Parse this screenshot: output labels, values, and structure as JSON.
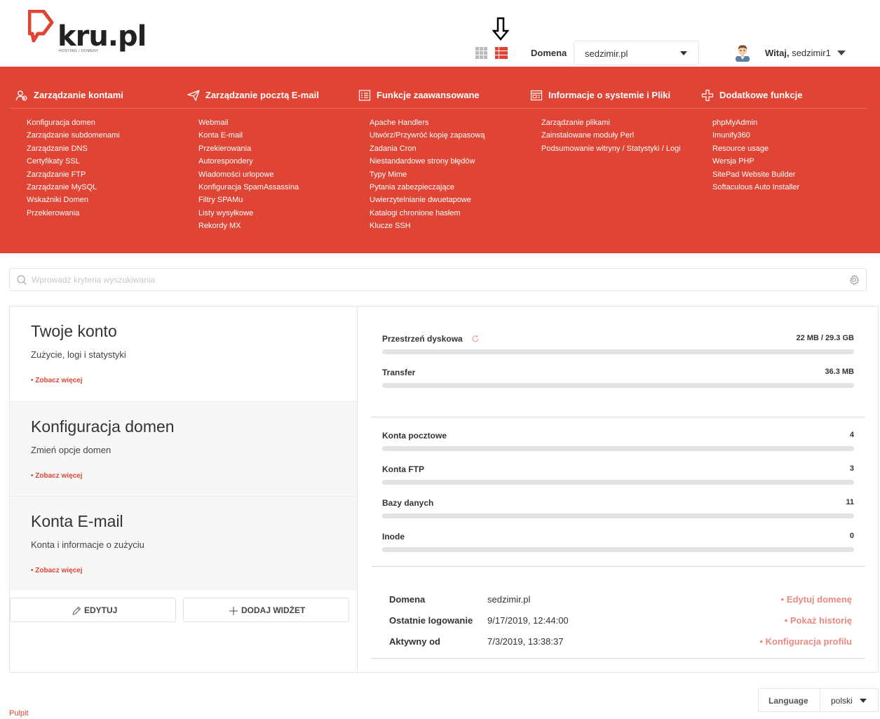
{
  "header": {
    "logo_text": "kru.pl",
    "logo_tagline": "HOSTING / DOMENY",
    "domain_label": "Domena",
    "domain_value": "sedzimir.pl",
    "greeting_prefix": "Witaj,",
    "username": "sedzimir1"
  },
  "menu": {
    "columns": [
      {
        "title": "Zarządzanie kontami",
        "icon": "users-icon",
        "items": [
          "Konfiguracja domen",
          "Zarządzanie subdomenami",
          "Zarządzanie DNS",
          "Certyfikaty SSL",
          "Zarządzanie FTP",
          "Zarządzanie MySQL",
          "Wskaźniki Domen",
          "Przekierowania"
        ]
      },
      {
        "title": "Zarządzanie pocztą E-mail",
        "icon": "paper-plane-icon",
        "items": [
          "Webmail",
          "Konta E-mail",
          "Przekierowania",
          "Autorespondery",
          "Wiadomości urlopowe",
          "Konfiguracja SpamAssassina",
          "Filtry SPAMu",
          "Listy wysyłkowe",
          "Rekordy MX"
        ]
      },
      {
        "title": "Funkcje zaawansowane",
        "icon": "list-icon",
        "items": [
          "Apache Handlers",
          "Utwórz/Przywróć kopię zapasową",
          "Zadania Cron",
          "Niestandardowe strony błędów",
          "Typy Mime",
          "Pytania zabezpieczające",
          "Uwierzytelnianie dwuetapowe",
          "Katalogi chronione hasłem",
          "Klucze SSH"
        ]
      },
      {
        "title": "Informacje o systemie i Pliki",
        "icon": "window-icon",
        "items": [
          "Zarządzanie plikami",
          "Zainstalowane moduły Perl",
          "Podsumowanie witryny / Statystyki / Logi"
        ]
      },
      {
        "title": "Dodatkowe funkcje",
        "icon": "plus-icon",
        "items": [
          "phpMyAdmin",
          "Imunify360",
          "Resource usage",
          "Wersja PHP",
          "SitePad Website Builder",
          "Softaculous Auto Installer"
        ]
      }
    ]
  },
  "search": {
    "placeholder": "Wprowadź kryteria wyszukiwania"
  },
  "widgets": [
    {
      "title": "Twoje konto",
      "subtitle": "Zużycie, logi i statystyki",
      "more": "• Zobacz więcej"
    },
    {
      "title": "Konfiguracja domen",
      "subtitle": "Zmień opcje domen",
      "more": "• Zobacz więcej"
    },
    {
      "title": "Konta E-mail",
      "subtitle": "Konta i informacje o zużyciu",
      "more": "• Zobacz więcej"
    }
  ],
  "buttons": {
    "edit": "EDYTUJ",
    "add_widget": "DODAJ WIDŻET"
  },
  "usage": [
    {
      "label": "Przestrzeń dyskowa",
      "value": "22 MB / 29.3 GB",
      "fill": 0.001
    },
    {
      "label": "Transfer",
      "value": "36.3 MB",
      "fill": 0
    }
  ],
  "counts": [
    {
      "label": "Konta pocztowe",
      "value": "4"
    },
    {
      "label": "Konta FTP",
      "value": "3"
    },
    {
      "label": "Bazy danych",
      "value": "11"
    },
    {
      "label": "Inode",
      "value": "0"
    }
  ],
  "info": [
    {
      "label": "Domena",
      "value": "sedzimir.pl",
      "action": "• Edytuj domenę"
    },
    {
      "label": "Ostatnie logowanie",
      "value": "9/17/2019, 12:44:00",
      "action": "• Pokaż historię"
    },
    {
      "label": "Aktywny od",
      "value": "7/3/2019, 13:38:37",
      "action": "• Konfiguracja profilu"
    }
  ],
  "footer": {
    "language_label": "Language",
    "language_value": "polski",
    "breadcrumb": "Pulpit"
  },
  "colors": {
    "accent": "#e04434",
    "link_light": "#e88a80"
  }
}
